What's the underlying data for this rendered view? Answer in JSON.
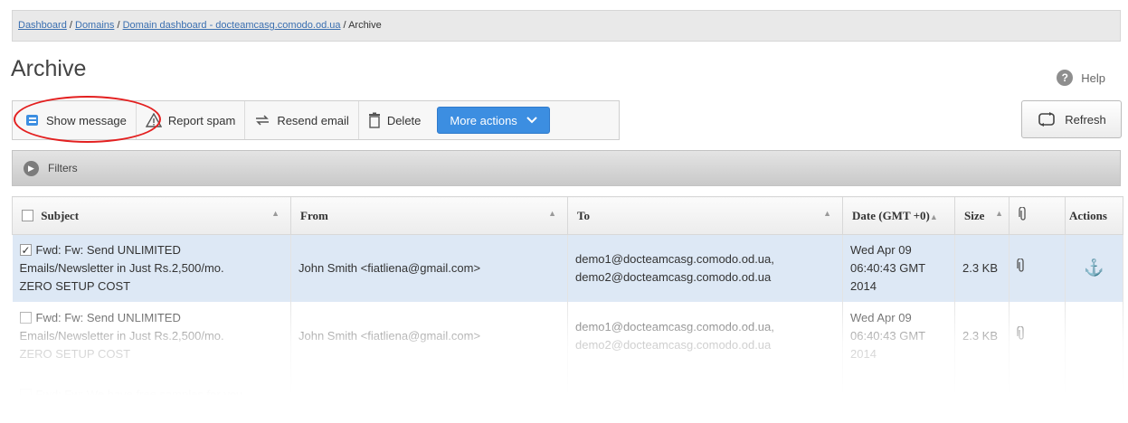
{
  "breadcrumb": {
    "links": [
      "Dashboard",
      "Domains",
      "Domain dashboard - docteamcasg.comodo.od.ua"
    ],
    "separator": " / ",
    "current": "Archive"
  },
  "page": {
    "title": "Archive",
    "help_label": "Help"
  },
  "toolbar": {
    "show_message": "Show message",
    "report_spam": "Report spam",
    "resend_email": "Resend email",
    "delete": "Delete",
    "more_actions": "More actions",
    "refresh": "Refresh"
  },
  "filters": {
    "label": "Filters"
  },
  "table": {
    "headers": {
      "subject": "Subject",
      "from": "From",
      "to": "To",
      "date": "Date (GMT +0)",
      "size": "Size",
      "actions": "Actions"
    },
    "rows": [
      {
        "checked": true,
        "subject_lines": [
          "Fwd: Fw: Send UNLIMITED",
          "Emails/Newsletter in Just Rs.2,500/mo.",
          "ZERO SETUP COST"
        ],
        "from": "John Smith <fiatliena@gmail.com>",
        "to_lines": [
          "demo1@docteamcasg.comodo.od.ua,",
          "demo2@docteamcasg.comodo.od.ua"
        ],
        "date_lines": [
          "Wed Apr 09",
          "06:40:43 GMT",
          "2014"
        ],
        "size": "2.3 KB"
      },
      {
        "checked": false,
        "subject_lines": [
          "Fwd: Fw: Send UNLIMITED",
          "Emails/Newsletter in Just Rs.2,500/mo.",
          "ZERO SETUP COST"
        ],
        "from": "John Smith <fiatliena@gmail.com>",
        "to_lines": [
          "demo1@docteamcasg.comodo.od.ua,",
          "demo2@docteamcasg.comodo.od.ua"
        ],
        "date_lines": [
          "Wed Apr 09",
          "06:40:43 GMT",
          "2014"
        ],
        "size": "2.3 KB"
      },
      {
        "checked": false,
        "subject_lines": [
          "Fwd: Fw: We have free samples for you"
        ]
      }
    ]
  },
  "icons": {
    "show_message": "message-icon",
    "report_spam": "warning-icon",
    "resend_email": "resend-icon",
    "delete": "trash-icon",
    "more_actions": "chevron-down-icon",
    "refresh": "refresh-icon",
    "help": "help-icon",
    "filters": "filter-toggle-icon",
    "attachment": "paperclip-icon",
    "action": "anchor-icon"
  },
  "colors": {
    "accent": "#3c8ee1",
    "selected_row": "#dde8f5",
    "highlight_ring": "#e32020",
    "link": "#3a6fb0"
  }
}
